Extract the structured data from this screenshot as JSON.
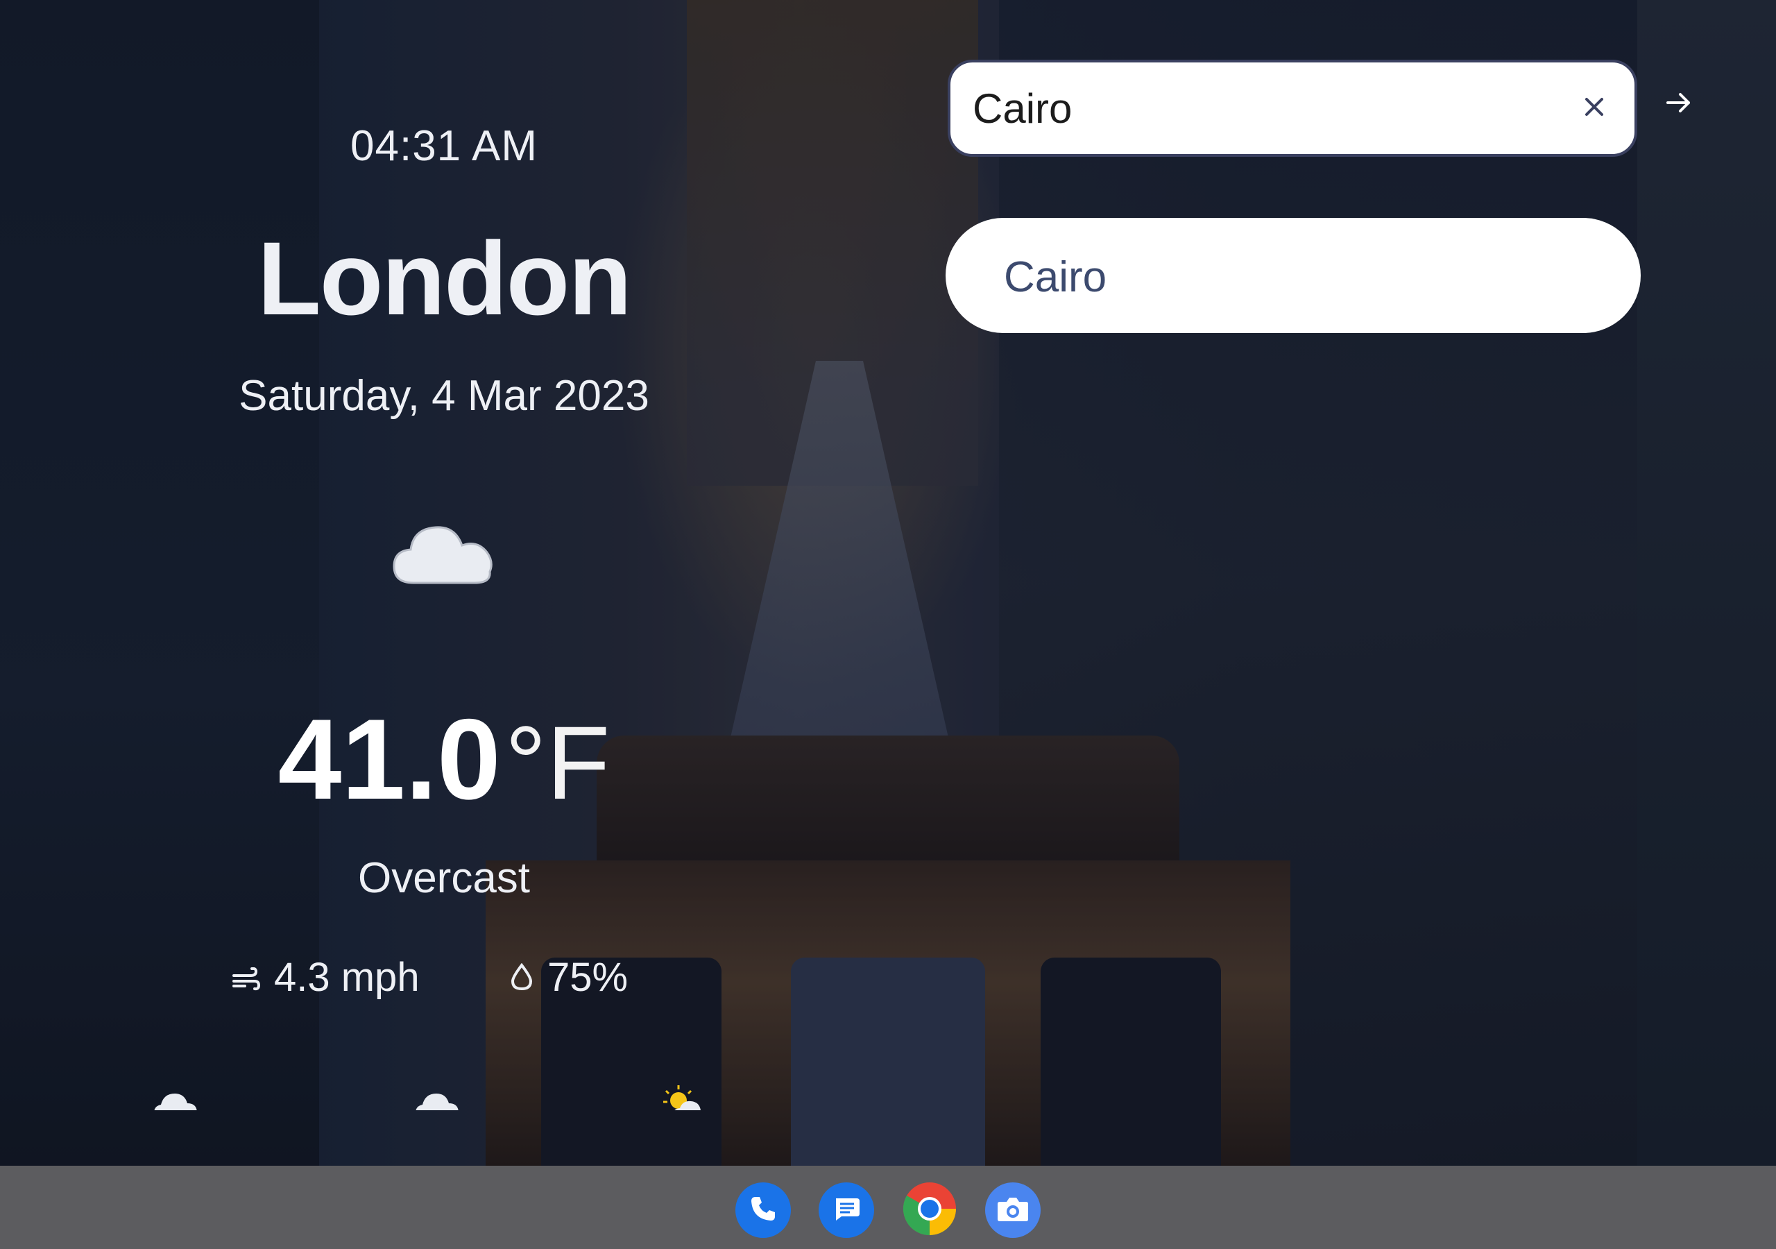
{
  "weather": {
    "time": "04:31 AM",
    "city": "London",
    "date": "Saturday, 4 Mar 2023",
    "main_icon": "cloud-icon",
    "temperature": "41.0",
    "unit": "°F",
    "condition": "Overcast",
    "wind": "4.3 mph",
    "humidity": "75%",
    "forecast_icons": [
      "cloud-icon",
      "cloud-icon",
      "partly-sunny-icon"
    ]
  },
  "search": {
    "value": "Cairo",
    "suggestions": [
      "Cairo"
    ]
  },
  "taskbar": {
    "apps": [
      "phone",
      "messages",
      "chrome",
      "camera"
    ]
  },
  "colors": {
    "text": "#eef0f5",
    "search_border": "#3a4060",
    "suggestion_text": "#3c4a6e",
    "taskbar": "#5c5c5f",
    "dock_blue": "#1a73e8"
  }
}
